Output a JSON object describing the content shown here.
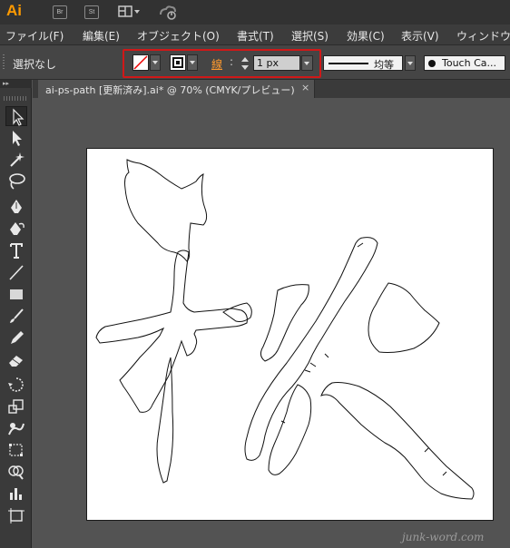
{
  "app": {
    "logo": "Ai",
    "bridge_button": "Br",
    "stock_button": "St"
  },
  "menu": [
    "ファイル(F)",
    "編集(E)",
    "オブジェクト(O)",
    "書式(T)",
    "選択(S)",
    "効果(C)",
    "表示(V)",
    "ウィンドウ"
  ],
  "control_bar": {
    "selection_status": "選択なし",
    "stroke_label": "線",
    "stroke_colon": ":",
    "stroke_weight": "1 px",
    "profile_label": "均等",
    "brush_label": "Touch Ca..."
  },
  "document": {
    "tab_title": "ai-ps-path [更新済み].ai* @ 70% (CMYK/プレビュー)",
    "close_glyph": "×"
  },
  "watermark": "junk-word.com",
  "colors": {
    "accent_orange": "#ff9a00",
    "highlight_red": "#d01818",
    "workspace": "#535353"
  },
  "tools": [
    "selection-tool",
    "direct-selection-tool",
    "magic-wand-tool",
    "lasso-tool",
    "pen-tool",
    "curvature-tool",
    "type-tool",
    "line-tool",
    "rectangle-tool",
    "paintbrush-tool",
    "pencil-tool",
    "eraser-tool",
    "rotate-tool",
    "scale-tool",
    "warp-tool",
    "free-transform-tool",
    "shape-builder-tool",
    "graph-tool",
    "artboard-tool"
  ]
}
